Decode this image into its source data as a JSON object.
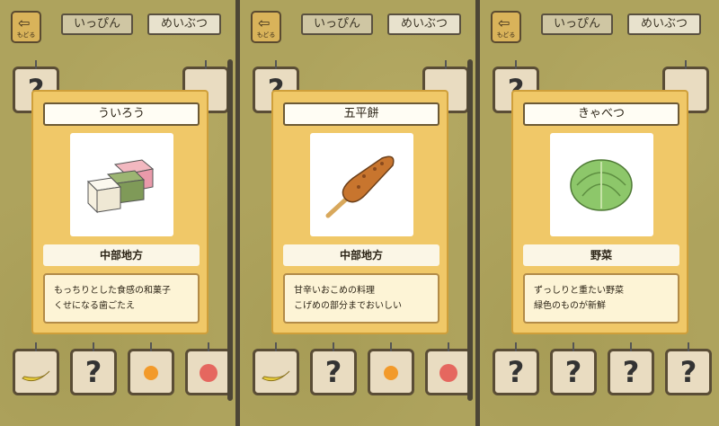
{
  "screens": [
    {
      "back_label": "もどる",
      "tabs": [
        "いっぴん",
        "めいぶつ"
      ],
      "item": {
        "name": "ういろう",
        "region": "中部地方",
        "desc": [
          "もっちりとした食感の和菓子",
          "くせになる歯ごたえ"
        ],
        "icon": "uiro-icon"
      }
    },
    {
      "back_label": "もどる",
      "tabs": [
        "いっぴん",
        "めいぶつ"
      ],
      "item": {
        "name": "五平餅",
        "region": "中部地方",
        "desc": [
          "甘辛いおこめの料理",
          "こげめの部分までおいしい"
        ],
        "icon": "gohei-mochi-icon"
      }
    },
    {
      "back_label": "もどる",
      "tabs": [
        "いっぴん",
        "めいぶつ"
      ],
      "item": {
        "name": "きゃべつ",
        "region": "野菜",
        "desc": [
          "ずっしりと重たい野菜",
          "緑色のものが新鮮"
        ],
        "icon": "cabbage-icon"
      }
    }
  ],
  "unknown_mark": "?"
}
